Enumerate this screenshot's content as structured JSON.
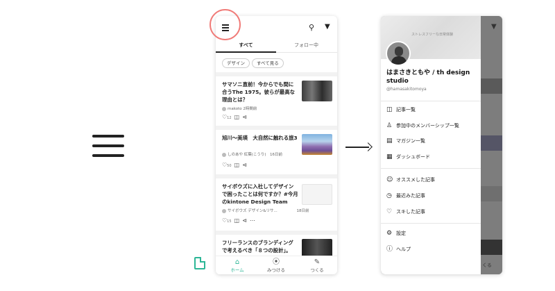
{
  "phone1": {
    "tabs": [
      "すべて",
      "フォロー中"
    ],
    "chips": [
      "デザイン",
      "すべて見る"
    ],
    "articles": [
      {
        "title": "サマソニ直前！今からでも間に合うThe 1975。彼らが最高な理由とは？",
        "author": "makoto",
        "time": "2時間前",
        "likes": "12"
      },
      {
        "title": "旭川〜美瑛　大自然に触れる旅3",
        "author": "しのあや",
        "time": "紅葉(こうり)　16日前",
        "likes": "50"
      },
      {
        "title": "サイボウズに入社してデザインで困ったことは何ですか？#今月のkintone Design Team",
        "author": "サイボウズ デザイン&リサ...",
        "time": "18日前",
        "likes": "15"
      },
      {
        "title": "フリーランスのブランディングで考えるべき「８つの設計」。",
        "author": "",
        "time": "",
        "likes": ""
      }
    ],
    "bottom_nav": [
      "ホーム",
      "みつける",
      "つくる"
    ]
  },
  "phone2": {
    "cover_text": "ストレスフリーな日常体験",
    "name": "はまさきともや / th design studio",
    "handle": "@hamasakitomoya",
    "menu1": [
      "記事一覧",
      "参加中のメンバーシップ一覧",
      "マガジン一覧",
      "ダッシュボード"
    ],
    "menu2": [
      "オススメした記事",
      "最近みた記事",
      "スキした記事"
    ],
    "menu3": [
      "設定",
      "ヘルプ"
    ],
    "behind_text": "くる"
  },
  "colors": {
    "accent": "#2cb696",
    "highlight": "#f07b78"
  }
}
